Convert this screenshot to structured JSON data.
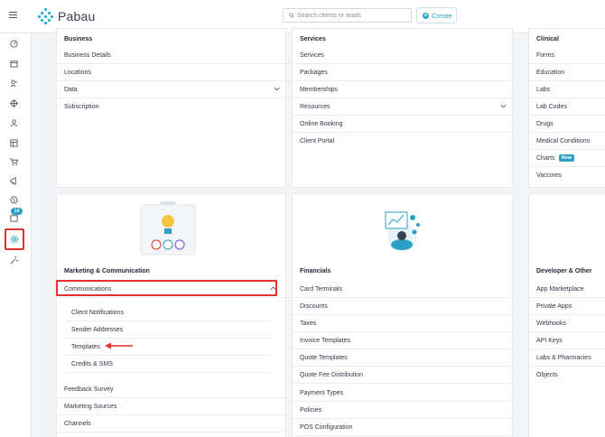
{
  "app": {
    "name": "Pabau"
  },
  "header": {
    "search_placeholder": "Search clients or leads",
    "create_label": "Create"
  },
  "sidebar": {
    "badge": "14",
    "icons": [
      "dashboard-icon",
      "calendar-icon",
      "leads-icon",
      "target-icon",
      "client-icon",
      "reports-icon",
      "cart-icon",
      "megaphone-icon",
      "dollar-icon",
      "inbox-icon",
      "settings-icon",
      "magic-wand-icon"
    ],
    "active": "settings-icon"
  },
  "sections": {
    "business": {
      "title": "Business",
      "items": [
        "Business Details",
        "Locations",
        "Data",
        "Subscription"
      ]
    },
    "services": {
      "title": "Services",
      "items": [
        "Services",
        "Packages",
        "Memberships",
        "Resources",
        "Online Booking",
        "Client Portal"
      ]
    },
    "clinical": {
      "title": "Clinical",
      "items": [
        "Forms",
        "Education",
        "Labs",
        "Lab Codes",
        "Drugs",
        "Medical Conditions",
        "Charts",
        "Vaccines"
      ],
      "new_badge": "New"
    },
    "marketing": {
      "title": "Marketing & Communication",
      "communications": "Communications",
      "sub_items": [
        "Client Notifications",
        "Sender Addresses",
        "Templates",
        "Credits & SMS"
      ],
      "items": [
        "Feedback Survey",
        "Marketing Sources",
        "Channels"
      ]
    },
    "financials": {
      "title": "Financials",
      "items": [
        "Card Terminals",
        "Discounts",
        "Taxes",
        "Invoice Templates",
        "Quote Templates",
        "Quote Fee Distribution",
        "Payment Types",
        "Policies",
        "POS Configuration"
      ]
    },
    "developer": {
      "title": "Developer & Other",
      "items": [
        "App Marketplace",
        "Private Apps",
        "Webhooks",
        "API Keys",
        "Labs & Pharmacies",
        "Objects"
      ]
    }
  },
  "colors": {
    "accent": "#2b9fc5",
    "highlight": "#e0322b"
  }
}
